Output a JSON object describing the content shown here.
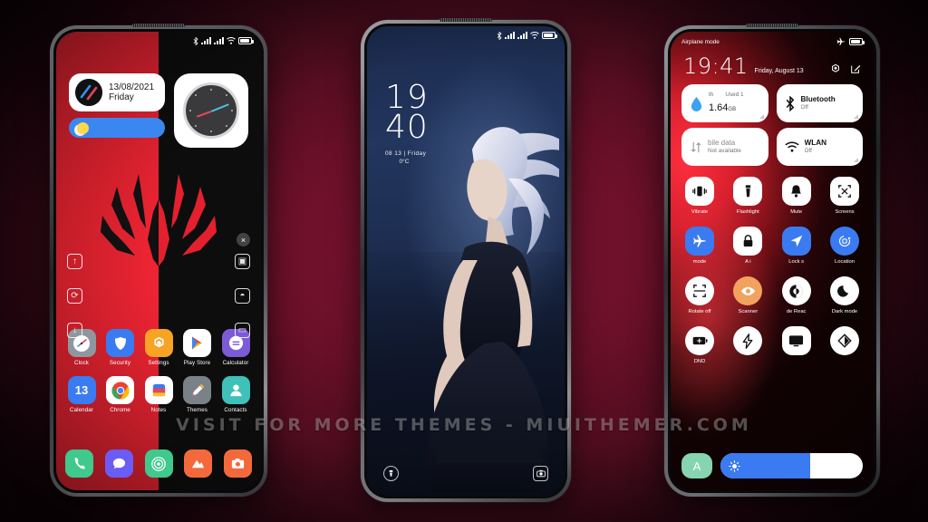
{
  "watermark": "VISIT FOR MORE THEMES  -  MIUITHEMER.COM",
  "colors": {
    "accent_red": "#ed2432",
    "dark": "#0d0d0d",
    "blue": "#3a7bf2",
    "background": "#6b1029"
  },
  "phone1": {
    "name": "home-screen",
    "statusbar": {
      "icons": [
        "bluetooth-icon",
        "signal-icon",
        "signal-icon",
        "wifi-icon",
        "battery-icon"
      ]
    },
    "date_widget": {
      "date": "13/08/2021",
      "day": "Friday"
    },
    "weather_widget": {
      "icon": "sun-icon"
    },
    "clock_widget": {
      "icon": "analog-clock"
    },
    "wallpaper": "spiderman-split-red-black",
    "side_left_icons": [
      "arrow-up-icon",
      "refresh-icon",
      "arrow-down-icon"
    ],
    "side_right_icons": [
      "image-icon",
      "droplet-icon",
      "window-icon"
    ],
    "close_button": "×",
    "apps": [
      [
        {
          "label": "Clock",
          "icon": "clock-icon",
          "bg": "#8f979e"
        },
        {
          "label": "Security",
          "icon": "shield-icon",
          "bg": "#3a7bf2"
        },
        {
          "label": "Settings",
          "icon": "gear-icon",
          "bg": "#f7a324"
        },
        {
          "label": "Play Store",
          "icon": "play-store-icon",
          "bg": "#ffffff"
        },
        {
          "label": "Calculator",
          "icon": "calculator-icon",
          "bg": "#7e5bd6"
        }
      ],
      [
        {
          "label": "Calendar",
          "icon": "calendar-icon",
          "bg": "#3a7bf2",
          "day": "13"
        },
        {
          "label": "Chrome",
          "icon": "chrome-icon",
          "bg": "#ffffff"
        },
        {
          "label": "Notes",
          "icon": "notes-icon",
          "bg": "#ffffff"
        },
        {
          "label": "Themes",
          "icon": "pencil-icon",
          "bg": "#7a8288"
        },
        {
          "label": "Contacts",
          "icon": "person-icon",
          "bg": "#3fc0b8"
        }
      ]
    ],
    "dock": [
      {
        "name": "phone-icon",
        "bg": "#3fc98d"
      },
      {
        "name": "messages-icon",
        "bg": "#6b5cf6"
      },
      {
        "name": "browser-icon",
        "bg": "#3fc98d"
      },
      {
        "name": "gallery-icon",
        "bg": "#f4693c"
      },
      {
        "name": "camera-icon",
        "bg": "#f4693c"
      }
    ]
  },
  "phone2": {
    "name": "lock-screen",
    "statusbar": {
      "icons": [
        "bluetooth-icon",
        "signal-icon",
        "signal-icon",
        "wifi-icon",
        "battery-icon"
      ]
    },
    "time_hour": "19",
    "time_minute": "40",
    "date_line": "08 13  |  Friday",
    "temperature": "0°C",
    "bottom_left_icon": "flashlight-icon",
    "bottom_right_icon": "camera-icon",
    "wallpaper": "girl-white-hair-night-city"
  },
  "phone3": {
    "name": "control-center",
    "status_left": "Airplane mode",
    "status_icons": [
      "airplane-icon",
      "battery-icon"
    ],
    "time": "19:41",
    "date": "Friday, August 13",
    "header_actions": [
      "settings-gear-icon",
      "edit-icon"
    ],
    "big_tiles": [
      {
        "title": "th",
        "sub": "Used 1",
        "value": "1.64",
        "unit": "GB",
        "icon": "droplet-icon",
        "type": "data"
      },
      {
        "title": "Bluetooth",
        "sub": "Off",
        "icon": "bluetooth-icon",
        "type": "toggle"
      },
      {
        "title": "bile data",
        "sub": "Not available",
        "icon": "data-arrows-icon",
        "type": "toggle"
      },
      {
        "title": "WLAN",
        "sub": "Off",
        "icon": "wifi-icon",
        "type": "toggle"
      }
    ],
    "toggles": [
      [
        {
          "label": "Vibrate",
          "icon": "vibrate-icon",
          "on": false,
          "shape": "rounded"
        },
        {
          "label": "Flashlight",
          "icon": "flashlight-icon",
          "on": false,
          "shape": "rounded"
        },
        {
          "label": "Mute",
          "icon": "bell-icon",
          "on": false,
          "shape": "rounded"
        },
        {
          "label": "Screens",
          "icon": "screenshot-icon",
          "on": false,
          "shape": "rounded"
        }
      ],
      [
        {
          "label": "mode",
          "icon": "airplane-icon",
          "on": true,
          "shape": "rounded"
        },
        {
          "label": "A      i",
          "icon": "lock-icon",
          "on": false,
          "shape": "rounded"
        },
        {
          "label": "Lock s",
          "icon": "location-icon",
          "on": true,
          "shape": "rounded"
        },
        {
          "label": "Location",
          "icon": "rotate-icon",
          "on": true,
          "shape": "circle"
        }
      ],
      [
        {
          "label": "Rotate off",
          "icon": "scanner-icon",
          "on": false,
          "shape": "circle"
        },
        {
          "label": "Scanner",
          "icon": "eye-icon",
          "on": false,
          "shape": "circle",
          "bg": "#f2a25e"
        },
        {
          "label": "de    Reac",
          "icon": "contrast-icon",
          "on": false,
          "shape": "circle"
        },
        {
          "label": "Dark mode",
          "icon": "moon-icon",
          "on": false,
          "shape": "circle"
        }
      ],
      [
        {
          "label": "DND",
          "icon": "battery-saver-icon",
          "on": false,
          "shape": "circle"
        },
        {
          "label": "",
          "icon": "bolt-icon",
          "on": false,
          "shape": "circle"
        },
        {
          "label": "",
          "icon": "cast-icon",
          "on": false,
          "shape": "rounded"
        },
        {
          "label": "",
          "icon": "reading-mode-icon",
          "on": false,
          "shape": "circle"
        }
      ]
    ],
    "toggle_row_labels": [
      [
        "Vibrate",
        "Flashlight",
        "Mute",
        "Screens"
      ],
      [
        "mode",
        "A     i",
        "Lock s",
        "Location"
      ],
      [
        "Rotate off",
        "Scanner",
        "de   Reac",
        "Dark mode"
      ],
      [
        "DND",
        "",
        "",
        ""
      ]
    ],
    "brightness": {
      "auto_label": "A",
      "icon": "brightness-icon",
      "value_percent": 63
    }
  }
}
